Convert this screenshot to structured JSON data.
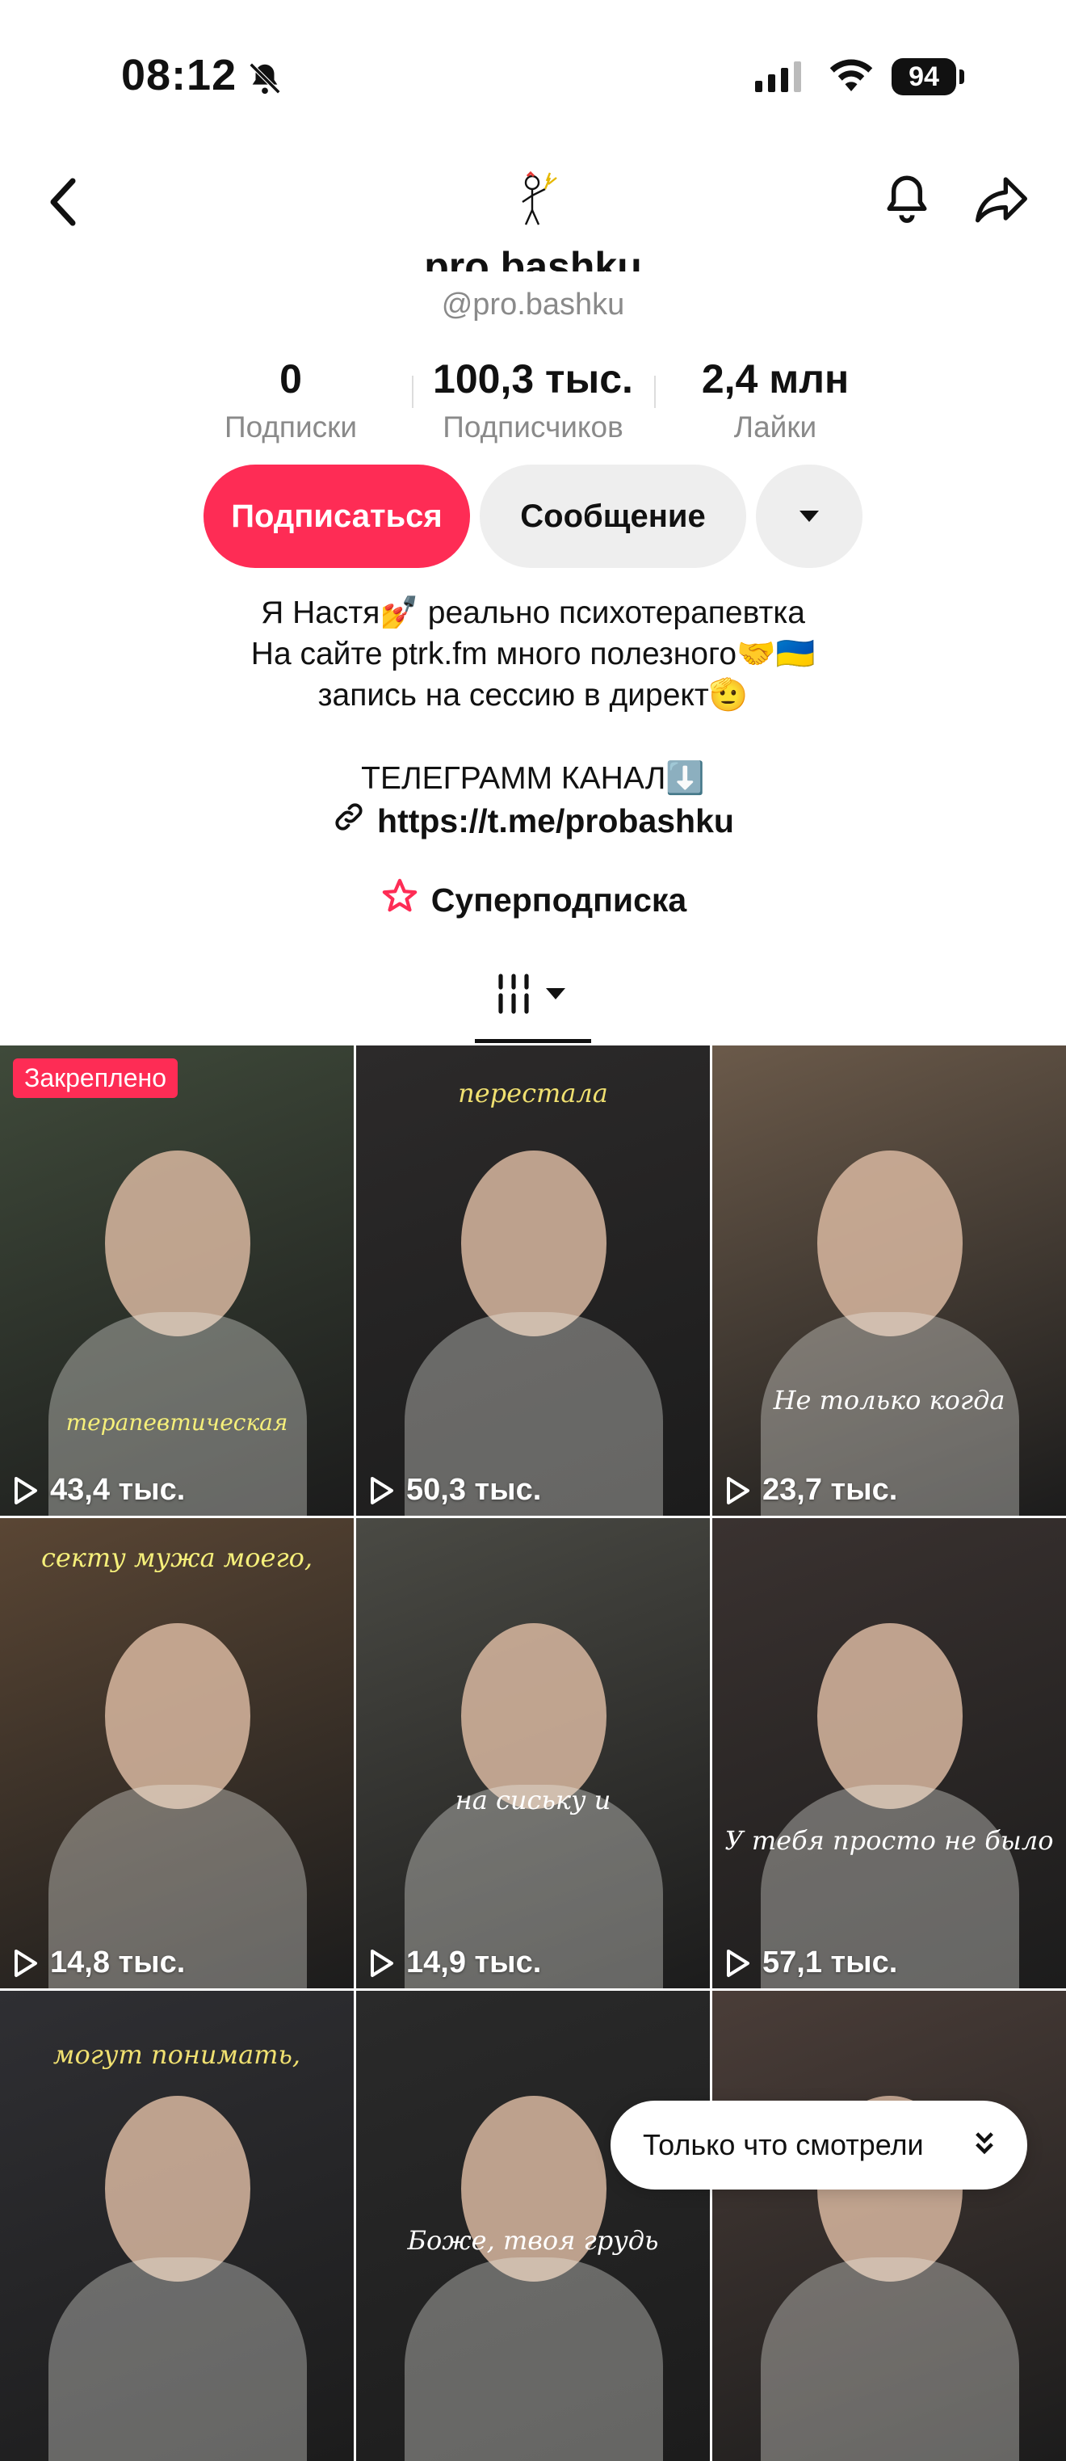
{
  "status_bar": {
    "time": "08:12",
    "battery": "94"
  },
  "profile": {
    "display_name": "pro.bashku",
    "handle": "@pro.bashku"
  },
  "stats": [
    {
      "value": "0",
      "label": "Подписки"
    },
    {
      "value": "100,3 тыс.",
      "label": "Подписчиков"
    },
    {
      "value": "2,4 млн",
      "label": "Лайки"
    }
  ],
  "actions": {
    "follow": "Подписаться",
    "message": "Сообщение"
  },
  "bio": {
    "line1": "Я Настя💅 реально психотерапевтка",
    "line2": "На сайте ptrk.fm много полезного🤝🇺🇦",
    "line3": "запись на сессию в директ🫡",
    "line4": "ТЕЛЕГРАММ КАНАЛ⬇️",
    "link": "https://t.me/probashku"
  },
  "superfollow": "Суперподписка",
  "videos": [
    {
      "views": "43,4 тыс.",
      "pinned_label": "Закреплено",
      "caption": "терапевтическая",
      "bg": "#3f4a3a"
    },
    {
      "views": "50,3 тыс.",
      "caption": "перестала",
      "bg": "#2c2a2a"
    },
    {
      "views": "23,7 тыс.",
      "caption": "Не только когда",
      "bg": "#6b5a4a"
    },
    {
      "views": "14,8 тыс.",
      "caption": "секту мужа моего,",
      "bg": "#5a4634"
    },
    {
      "views": "14,9 тыс.",
      "caption": "на сиську и",
      "bg": "#4a4a44"
    },
    {
      "views": "57,1 тыс.",
      "caption": "У тебя просто не было",
      "bg": "#3a3230"
    },
    {
      "caption": "могут понимать,",
      "bg": "#2f2f33"
    },
    {
      "caption": "Боже, твоя грудь",
      "bg": "#2a2a2a"
    },
    {
      "caption": "",
      "bg": "#4a3d38"
    }
  ],
  "toast": {
    "label": "Только что смотрели"
  },
  "colors": {
    "accent": "#fe2c55",
    "secondary_button": "#eeeeee",
    "muted_text": "#8a8a8a"
  }
}
